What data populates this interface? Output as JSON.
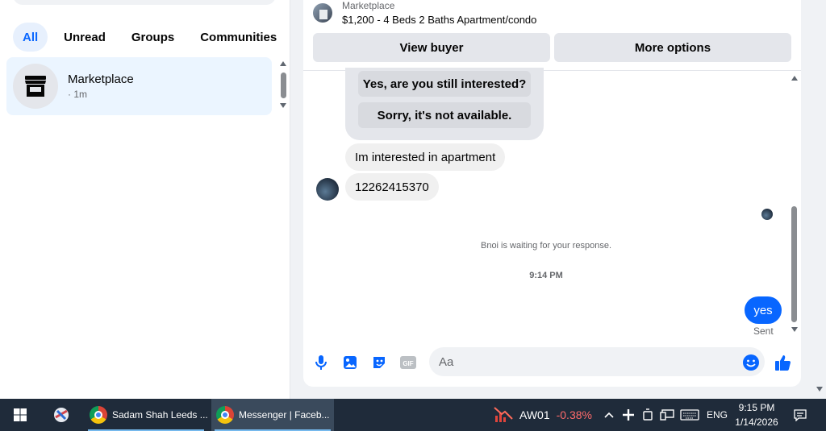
{
  "filters": {
    "all": "All",
    "unread": "Unread",
    "groups": "Groups",
    "communities": "Communities"
  },
  "conversation": {
    "title": "Marketplace",
    "time": "· 1m"
  },
  "listing": {
    "label": "Marketplace",
    "title": "$1,200 - 4 Beds 2 Baths Apartment/condo",
    "view_buyer": "View buyer",
    "more_options": "More options"
  },
  "messages": {
    "quick_reply_1": "Yes, are you still interested?",
    "quick_reply_2": "Sorry, it's not available.",
    "incoming_1": "Im interested in apartment",
    "incoming_2": "12262415370",
    "waiting": "Bnoi is waiting for your response.",
    "timestamp": "9:14 PM",
    "outgoing_1": "yes",
    "status": "Sent"
  },
  "composer": {
    "placeholder": "Aa"
  },
  "colors": {
    "accent": "#0866ff",
    "stock_down": "#ff6b6b"
  },
  "taskbar": {
    "app_1": "Sadam Shah Leeds ...",
    "app_2": "Messenger | Faceb...",
    "stock_symbol": "AW01",
    "stock_change": "-0.38%",
    "language": "ENG",
    "time": "9:15 PM",
    "date": "1/14/2026"
  }
}
